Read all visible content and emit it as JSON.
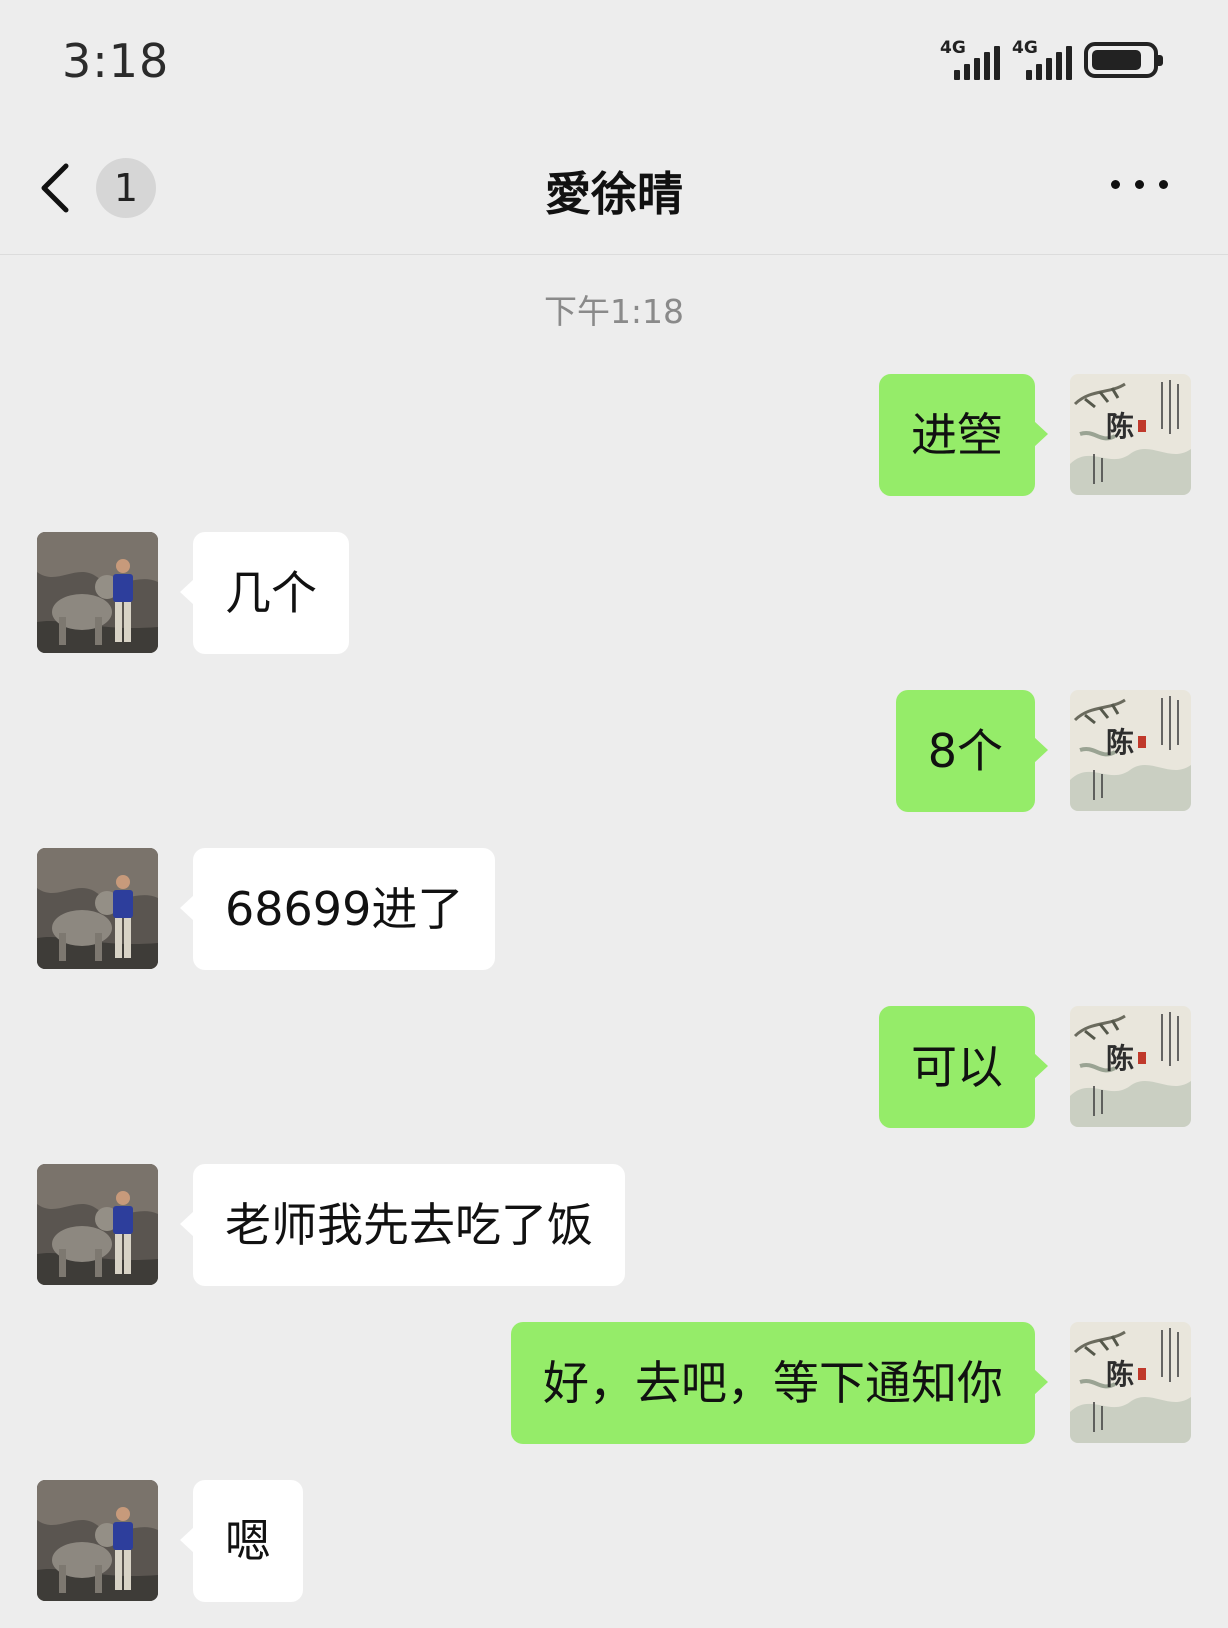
{
  "status": {
    "time": "3:18",
    "signal1": "4G",
    "signal2": "4G",
    "battery_level": 0.85
  },
  "header": {
    "unread_count": "1",
    "title": "愛徐晴"
  },
  "timestamp": "下午1:18",
  "messages": [
    {
      "side": "out",
      "text": "进箜"
    },
    {
      "side": "in",
      "text": "几个"
    },
    {
      "side": "out",
      "text": "8个"
    },
    {
      "side": "in",
      "text": "68699进了"
    },
    {
      "side": "out",
      "text": "可以"
    },
    {
      "side": "in",
      "text": "老师我先去吃了饭"
    },
    {
      "side": "out",
      "text": "好，去吧，等下通知你"
    },
    {
      "side": "in",
      "text": "嗯"
    }
  ],
  "colors": {
    "background": "#ededed",
    "outgoing_bubble": "#95ec69",
    "incoming_bubble": "#ffffff"
  },
  "icons": {
    "back": "chevron-left-icon",
    "more": "more-dots-icon",
    "signal": "signal-icon",
    "battery": "battery-icon"
  }
}
